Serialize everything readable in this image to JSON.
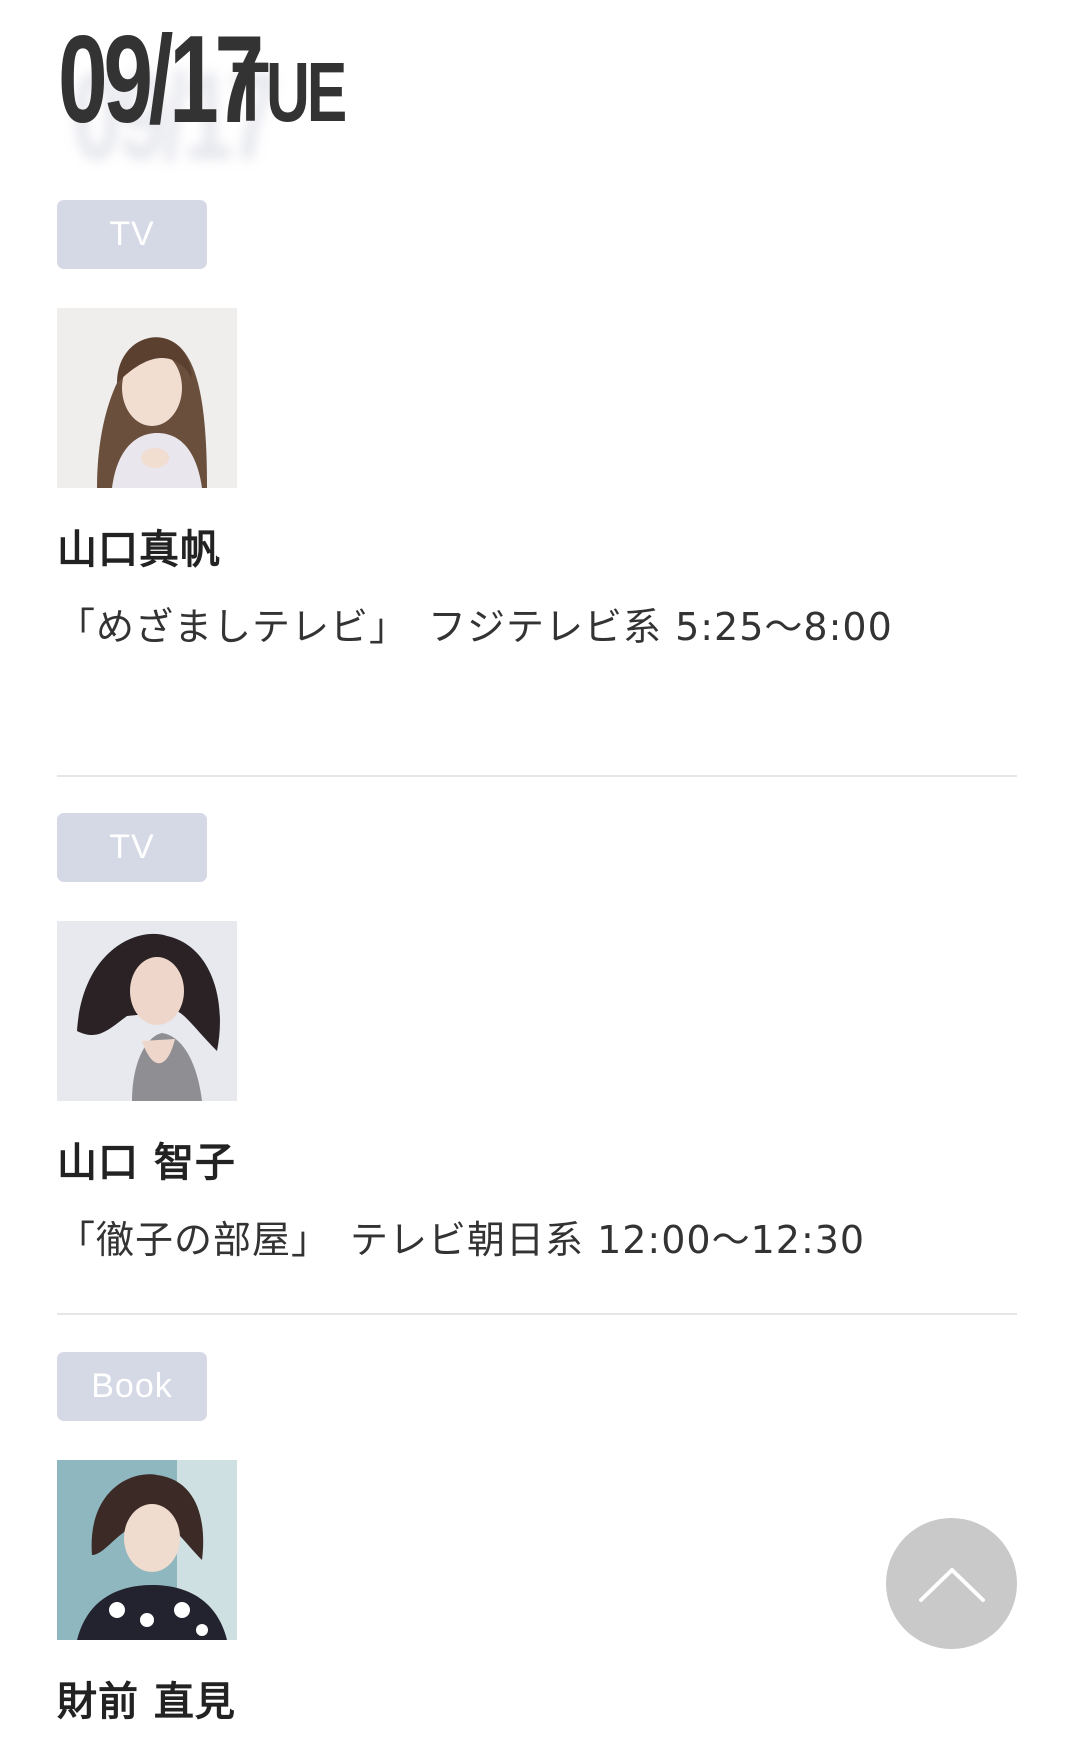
{
  "date": {
    "number": "09/17",
    "day": "TUE"
  },
  "entries": [
    {
      "category": "TV",
      "photo_icon": "portrait-photo",
      "name": "山口真帆",
      "program": "「めざましテレビ」　フジテレビ系 5:25〜8:00"
    },
    {
      "category": "TV",
      "photo_icon": "portrait-photo",
      "name": "山口 智子",
      "program": "「徹子の部屋」　テレビ朝日系 12:00〜12:30"
    },
    {
      "category": "Book",
      "photo_icon": "portrait-photo",
      "name": "財前 直見",
      "program": ""
    }
  ],
  "scroll_top": {
    "icon": "chevron-up-icon"
  },
  "colors": {
    "badge_bg": "#d5d9e6",
    "badge_text": "#ffffff",
    "divider": "#e6e6e6",
    "scroll_button": "#c9c9c9"
  }
}
